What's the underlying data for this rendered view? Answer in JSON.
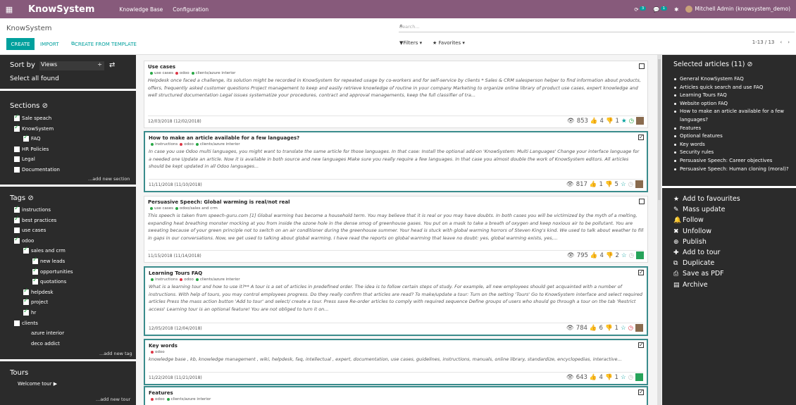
{
  "topbar": {
    "app_name": "KnowSystem",
    "menu": [
      "Knowledge Base",
      "Configuration"
    ],
    "activity_badge": "3",
    "chat_badge": "1",
    "user": "Mitchell Admin (knowsystem_demo)"
  },
  "control": {
    "breadcrumb": "KnowSystem",
    "search_placeholder": "Search...",
    "create": "CREATE",
    "import": "IMPORT",
    "create_template": "CREATE FROM TEMPLATE",
    "filters": "Filters",
    "favorites": "Favorites",
    "pager": "1-13 / 13"
  },
  "sidebar": {
    "sort_label": "Sort by",
    "sort_value": "Views",
    "select_all": "Select all found",
    "sections_title": "Sections",
    "sections": [
      {
        "label": "Sale speach",
        "checked": true,
        "level": 0
      },
      {
        "label": "KnowSystem",
        "checked": true,
        "level": 0
      },
      {
        "label": "FAQ",
        "checked": true,
        "level": 1
      },
      {
        "label": "HR Policies",
        "checked": false,
        "level": 0
      },
      {
        "label": "Legal",
        "checked": false,
        "level": 0
      },
      {
        "label": "Documentation",
        "checked": false,
        "level": 0
      }
    ],
    "add_section": "...add new section",
    "tags_title": "Tags",
    "tags": [
      {
        "label": "instructions",
        "checked": true,
        "level": 0
      },
      {
        "label": "best practices",
        "checked": true,
        "level": 0
      },
      {
        "label": "use cases",
        "checked": false,
        "level": 0
      },
      {
        "label": "odoo",
        "checked": true,
        "level": 0
      },
      {
        "label": "sales and crm",
        "checked": true,
        "level": 1
      },
      {
        "label": "new leads",
        "checked": true,
        "level": 2
      },
      {
        "label": "opportunities",
        "checked": true,
        "level": 2
      },
      {
        "label": "quotations",
        "checked": true,
        "level": 2
      },
      {
        "label": "helpdesk",
        "checked": true,
        "level": 1
      },
      {
        "label": "project",
        "checked": true,
        "level": 1
      },
      {
        "label": "hr",
        "checked": true,
        "level": 1
      },
      {
        "label": "clients",
        "checked": false,
        "level": 0
      },
      {
        "label": "azure interior",
        "checked": null,
        "level": 1
      },
      {
        "label": "deco addict",
        "checked": null,
        "level": 1
      }
    ],
    "add_tag": "...add new tag",
    "tours_title": "Tours",
    "tour_item": "Welcome tour ▶",
    "add_tour": "...add new tour"
  },
  "articles": [
    {
      "title": "Use cases",
      "tags": [
        {
          "name": "use cases",
          "color": "#28a745"
        },
        {
          "name": "odoo",
          "color": "#dc3545"
        },
        {
          "name": "clients/azure interior",
          "color": "#28a745"
        }
      ],
      "text": "Helpdesk once faced a challenge, its solution might be recorded in KnowSystem for repeated usage by co-workers and for self-service by clients * Sales & CRM salesperson helper to find information about products, offers, frequently asked customer questions Project management to keep and easily retrieve knowledge of routine in your company Marketing to organize online library of product use cases, expert knowledge and well structured documentation Legal issues systematize your procedures, contract and approval managements, keep the full classifier of tra...",
      "date": "12/03/2018 (12/02/2018)",
      "views": "853",
      "likes": "4",
      "dislikes": "1",
      "selected": false,
      "favorite": true,
      "status": "ok",
      "avatar": "brown"
    },
    {
      "title": "How to make an article available for a few languages?",
      "tags": [
        {
          "name": "instructions",
          "color": "#28a745"
        },
        {
          "name": "odoo",
          "color": "#dc3545"
        },
        {
          "name": "clients/azure interior",
          "color": "#28a745"
        }
      ],
      "text": "In case you use Odoo multi languages, you might want to translate the same article for those languages. In that case: Install the optional add-on 'KnowSystem: Multi Languages' Change your interface language for a needed one Update an article. Now it is available in both source and new languages Make sure you really require a few languages. In that case you almost double the work of KnowSystem editors. All articles should be kept updated in all Odoo languages...",
      "date": "11/11/2018 (11/10/2018)",
      "views": "817",
      "likes": "1",
      "dislikes": "5",
      "selected": true,
      "favorite": false,
      "status": "none",
      "avatar": "brown"
    },
    {
      "title": "Persuasive Speech: Global warming is real/not real",
      "tags": [
        {
          "name": "use cases",
          "color": "#28a745"
        },
        {
          "name": "odoo/sales and crm",
          "color": "#28a745"
        }
      ],
      "text": "This speech is taken from  speech-guru.com [1] Global warming has become a household term. You may believe that it is real or you may have doubts. In both cases you will be victimized by the myth of a melting, expanding heat breathing monster mocking at you from inside the ozone hole in the dense smog of greenhouse gases. You put on a mask to take a breath of oxygen and keep noxious air to be pollutant. You are sweating because of your green principle not to switch on an air conditioner during the greenhouse summer. Your head is stuck with global warming horrors of Steven King's kind. We used to talk about weather to fill in gaps in our conversations. Now, we get used to talking about global warming. I have read the reports on global warming that leave no doubt: yes, global warming exists, yes,...",
      "date": "11/15/2018 (11/14/2018)",
      "views": "795",
      "likes": "4",
      "dislikes": "2",
      "selected": false,
      "favorite": false,
      "status": "none",
      "avatar": "green"
    },
    {
      "title": "Learning Tours FAQ",
      "tags": [
        {
          "name": "instructions",
          "color": "#28a745"
        },
        {
          "name": "odoo",
          "color": "#dc3545"
        },
        {
          "name": "clients/azure interior",
          "color": "#28a745"
        }
      ],
      "text": "What is a learning tour and how to use it?** A tour is a set of articles in predefined order. The idea is to follow certain steps of study. For example, all new employees should get acquainted with a number of instructions. With help of tours, you may control employees progress. Do they really confirm that articles are read? To make/update a tour: Turn on the setting 'Tours' Go to KnowSystem interface and select required articles Press the mass action button 'Add to tour' and select/ create a tour. Press save Re-order articles to comply with required sequence Define groups of users who should go through a tour on the tab 'Restrict access' Learning tour is an optional feature! You are not obliged to turn it on...",
      "date": "12/05/2018 (12/04/2018)",
      "views": "784",
      "likes": "6",
      "dislikes": "1",
      "selected": true,
      "favorite": false,
      "status": "late",
      "avatar": "brown"
    },
    {
      "title": "Key words",
      "tags": [
        {
          "name": "odoo",
          "color": "#dc3545"
        }
      ],
      "text": "knowledge base , kb, knowledge management , wiki, helpdesk, faq, intellectual , expert, documentation, use cases, guidelines, instructions, manuals, online library, standardize, encyclopedias, interactive...",
      "date": "11/22/2018 (11/21/2018)",
      "views": "643",
      "likes": "4",
      "dislikes": "1",
      "selected": true,
      "favorite": false,
      "status": "none",
      "avatar": "green"
    },
    {
      "title": "Features",
      "tags": [
        {
          "name": "odoo",
          "color": "#dc3545"
        },
        {
          "name": "clients/azure interior",
          "color": "#28a745"
        }
      ],
      "text": "",
      "date": "",
      "views": "",
      "likes": "",
      "dislikes": "",
      "selected": true,
      "favorite": false,
      "status": "none",
      "avatar": "none"
    }
  ],
  "right_panel": {
    "title": "Selected articles (11)",
    "selected": [
      "General KnowSystem FAQ",
      "Articles quick search and use FAQ",
      "Learning Tours FAQ",
      "Website option FAQ",
      "How to make an article available for a few languages?",
      "Features",
      "Optional features",
      "Key words",
      "Security rules",
      "Persuasive Speech: Career objectives",
      "Persuasive Speech: Human cloning (moral)?"
    ],
    "actions": [
      {
        "icon": "★",
        "label": "Add to favourites"
      },
      {
        "icon": "✎",
        "label": "Mass update"
      },
      {
        "icon": "🔔",
        "label": "Follow"
      },
      {
        "icon": "✖",
        "label": "Unfollow"
      },
      {
        "icon": "⊕",
        "label": "Publish"
      },
      {
        "icon": "✚",
        "label": "Add to tour"
      },
      {
        "icon": "⧉",
        "label": "Duplicate"
      },
      {
        "icon": "⎙",
        "label": "Save as PDF"
      },
      {
        "icon": "▤",
        "label": "Archive"
      }
    ]
  }
}
